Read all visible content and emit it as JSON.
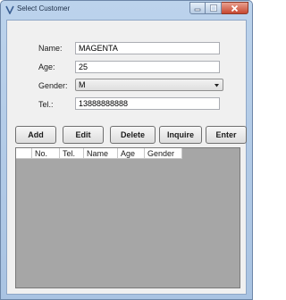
{
  "window": {
    "title": "Select Customer"
  },
  "form": {
    "name_label": "Name:",
    "name_value": "MAGENTA",
    "age_label": "Age:",
    "age_value": "25",
    "gender_label": "Gender:",
    "gender_value": "M",
    "tel_label": "Tel.:",
    "tel_value": "13888888888"
  },
  "toolbar": {
    "add_label": "Add",
    "edit_label": "Edit",
    "delete_label": "Delete",
    "inquire_label": "Inquire",
    "enter_label": "Enter"
  },
  "grid": {
    "columns": [
      "No.",
      "Tel.",
      "Name",
      "Age",
      "Gender"
    ]
  },
  "colors": {
    "window_frame": "#a9c3e2",
    "client_background": "#f0f0f0",
    "grid_background": "#a6a6a6",
    "close_button": "#c74831"
  },
  "icons": {
    "app": "app-icon",
    "minimize": "minimize-icon",
    "maximize": "maximize-icon",
    "close": "close-icon",
    "dropdown": "chevron-down-icon"
  }
}
